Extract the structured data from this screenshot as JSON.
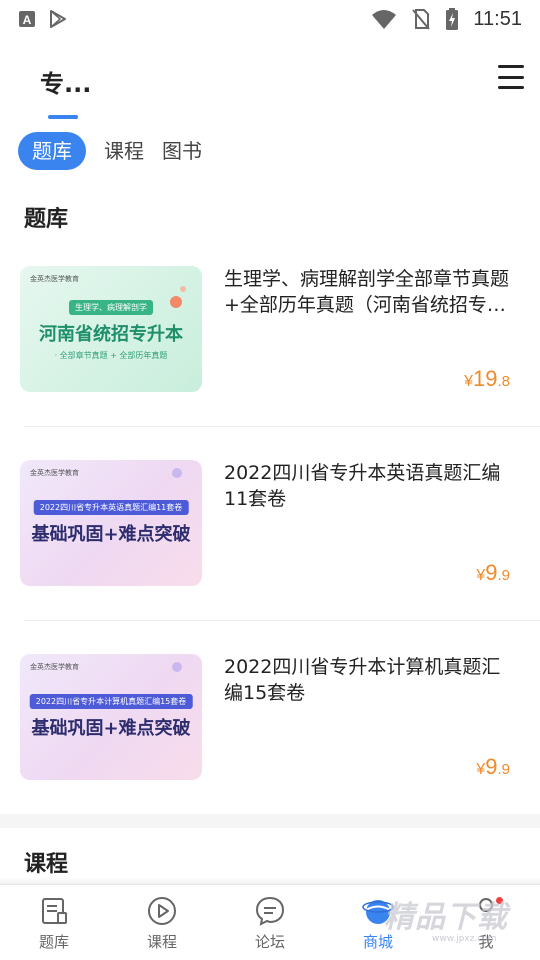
{
  "status_bar": {
    "time": "11:51"
  },
  "header": {
    "title": "专..."
  },
  "tabs": [
    {
      "label": "题库",
      "active": true
    },
    {
      "label": "课程",
      "active": false
    },
    {
      "label": "图书",
      "active": false
    }
  ],
  "sections": {
    "tiku_title": "题库",
    "kecheng_title": "课程"
  },
  "products": [
    {
      "name": "生理学、病理解剖学全部章节真题+全部历年真题（河南省统招专升本）",
      "price_currency": "¥",
      "price_int": "19",
      "price_dec": ".8",
      "thumb": {
        "logo": "金英杰医学教育",
        "pill": "生理学、病理解剖学",
        "main": "河南省统招专升本",
        "sub": "· 全部章节真题 + 全部历年真题"
      }
    },
    {
      "name": "2022四川省专升本英语真题汇编11套卷",
      "price_currency": "¥",
      "price_int": "9",
      "price_dec": ".9",
      "thumb": {
        "logo": "金英杰医学教育",
        "pill": "2022四川省专升本英语真题汇编11套卷",
        "main": "基础巩固+难点突破"
      }
    },
    {
      "name": "2022四川省专升本计算机真题汇编15套卷",
      "price_currency": "¥",
      "price_int": "9",
      "price_dec": ".9",
      "thumb": {
        "logo": "金英杰医学教育",
        "pill": "2022四川省专升本计算机真题汇编15套卷",
        "main": "基础巩固+难点突破"
      }
    }
  ],
  "bottom_nav": [
    {
      "label": "题库",
      "icon": "question-bank-icon",
      "active": false
    },
    {
      "label": "课程",
      "icon": "play-circle-icon",
      "active": false
    },
    {
      "label": "论坛",
      "icon": "chat-bubble-icon",
      "active": false
    },
    {
      "label": "商城",
      "icon": "planet-icon",
      "active": true
    },
    {
      "label": "我",
      "icon": "profile-icon",
      "active": false
    }
  ],
  "watermark": {
    "text": "精品下载",
    "sub": "www.jpxz.com"
  },
  "colors": {
    "accent": "#3a84f0",
    "price": "#f08a2a",
    "badge": "#f04040"
  }
}
